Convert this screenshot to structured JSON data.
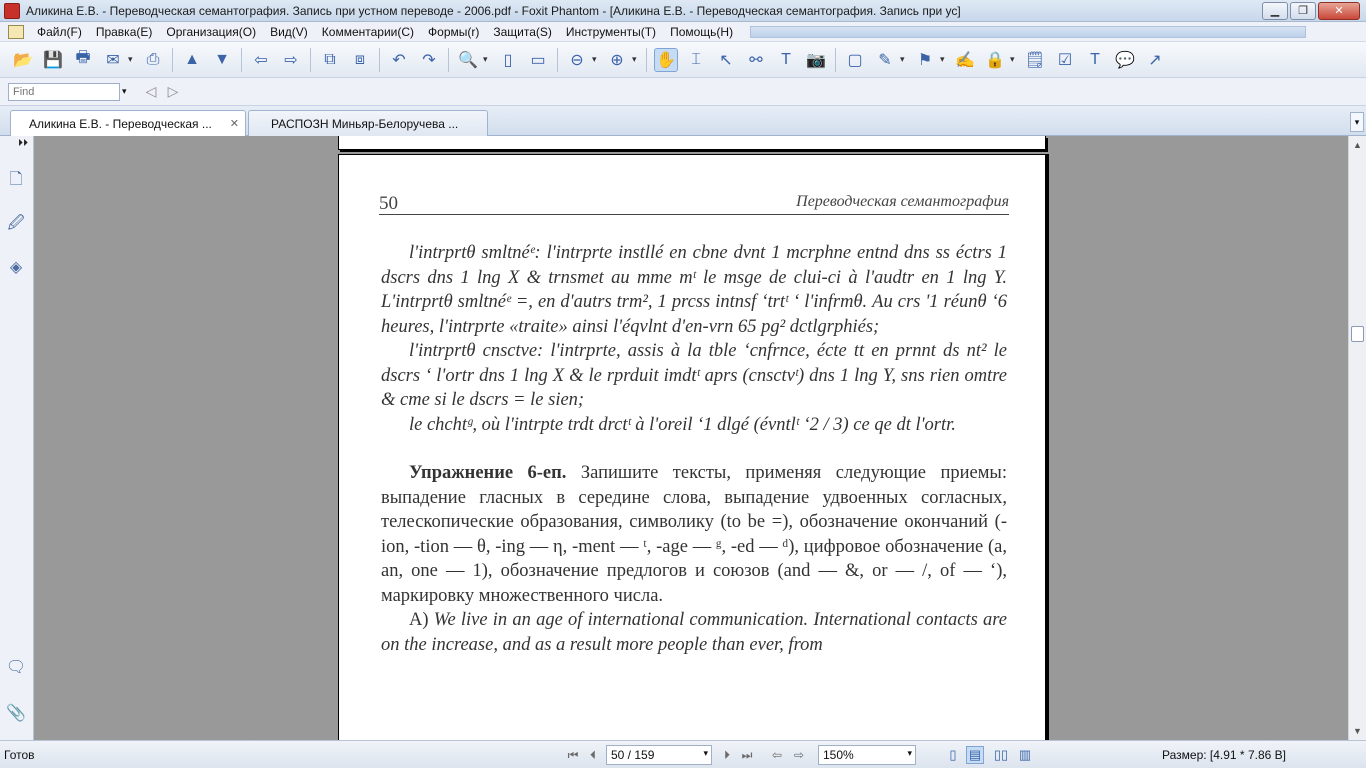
{
  "window": {
    "title": "Аликина Е.В. - Переводческая семантография. Запись при устном переводе - 2006.pdf - Foxit Phantom - [Аликина Е.В. - Переводческая семантография. Запись при ус]",
    "minimize": "▁",
    "restore": "❐",
    "close": "✕"
  },
  "menu": {
    "items": [
      "Файл(F)",
      "Правка(E)",
      "Организация(O)",
      "Вид(V)",
      "Комментарии(C)",
      "Формы(r)",
      "Защита(S)",
      "Инструменты(T)",
      "Помощь(H)"
    ]
  },
  "toolbar": {
    "icons": [
      {
        "name": "open-icon",
        "glyph": "📂"
      },
      {
        "name": "save-icon",
        "glyph": "💾"
      },
      {
        "name": "print-icon",
        "glyph": "🖶"
      },
      {
        "name": "email-icon",
        "glyph": "✉"
      },
      {
        "name": "scan-icon",
        "glyph": "⎙"
      },
      {
        "name": "page-up-icon",
        "glyph": "▲"
      },
      {
        "name": "page-down-icon",
        "glyph": "▼"
      },
      {
        "name": "back-icon",
        "glyph": "⇦"
      },
      {
        "name": "forward-icon",
        "glyph": "⇨"
      },
      {
        "name": "extract-icon",
        "glyph": "⧉"
      },
      {
        "name": "insert-icon",
        "glyph": "⧈"
      },
      {
        "name": "undo-icon",
        "glyph": "↶"
      },
      {
        "name": "redo-icon",
        "glyph": "↷"
      },
      {
        "name": "zoom-icon",
        "glyph": "🔍"
      },
      {
        "name": "fit-page-icon",
        "glyph": "▯"
      },
      {
        "name": "fit-width-icon",
        "glyph": "▭"
      },
      {
        "name": "zoom-out-icon",
        "glyph": "⊖"
      },
      {
        "name": "zoom-in-icon",
        "glyph": "⊕"
      },
      {
        "name": "hand-tool-icon",
        "glyph": "✋"
      },
      {
        "name": "text-select-icon",
        "glyph": "⌶"
      },
      {
        "name": "arrow-select-icon",
        "glyph": "↖"
      },
      {
        "name": "binoculars-icon",
        "glyph": "⚯"
      },
      {
        "name": "typewriter-icon",
        "glyph": "T"
      },
      {
        "name": "snapshot-icon",
        "glyph": "📷"
      },
      {
        "name": "textbox-icon",
        "glyph": "▢"
      },
      {
        "name": "edit-icon",
        "glyph": "✎"
      },
      {
        "name": "stamp-icon",
        "glyph": "⚑"
      },
      {
        "name": "sign-icon",
        "glyph": "✍"
      },
      {
        "name": "lock-icon",
        "glyph": "🔒"
      },
      {
        "name": "note-icon",
        "glyph": "🗒"
      },
      {
        "name": "check-note-icon",
        "glyph": "☑"
      },
      {
        "name": "text-note-icon",
        "glyph": "T"
      },
      {
        "name": "comment-icon",
        "glyph": "💬"
      },
      {
        "name": "arrow-tool-icon",
        "glyph": "↗"
      }
    ]
  },
  "find": {
    "placeholder": "Find",
    "prev": "◁",
    "next": "▷"
  },
  "tabs": [
    {
      "label": "Аликина Е.В. - Переводческая ...",
      "close": "✕"
    },
    {
      "label": "РАСПОЗН Миньяр-Белоручева ..."
    }
  ],
  "tab_scroll": "▾",
  "sidepanel": {
    "collapse": "⏵⏵",
    "icons": [
      {
        "name": "pages-icon",
        "glyph": "🗋"
      },
      {
        "name": "bookmarks-icon",
        "glyph": "🖉"
      },
      {
        "name": "layers-icon",
        "glyph": "◈"
      },
      {
        "name": "comments-panel-icon",
        "glyph": "🗨"
      },
      {
        "name": "attachments-icon",
        "glyph": "📎"
      }
    ]
  },
  "page": {
    "number": "50",
    "header": "Переводческая семантография",
    "p1": "l'intrprtθ smltnéᵉ: l'intrprte instllé en cbne dvnt 1 mcrphne entnd dns ss éctrs 1 dscrs dns 1 lng X & trnsmet au mme mᵗ le msge de clui-ci à l'audtr en 1 lng Y. L'intrprtθ smltnéᵉ =, en d'autrs trm², 1 prcss intnsf ‘trtᵗ ‘ l'infrmθ. Au crs '1 réunθ ‘6 heures, l'intrprte «traite» ainsi l'éqvlnt d'en-vrn 65 pg² dctlgrphiés;",
    "p2": "l'intrprtθ cnsctve: l'intrprte, assis à la tble ‘cnfrnce, écte tt en prnnt ds nt² le dscrs ‘ l'ortr dns 1 lng X & le rprduit imdtᵗ aprs (cnsctvᵗ) dns 1 lng Y, sns rien omtre & cme si le dscrs = le sien;",
    "p3": "le chchtᵍ, où l'intrpte trdt drctᵗ à l'oreil ‘1 dlgé (évntlᵗ ‘2 / 3) ce qe dt l'ortr.",
    "ex_title": "Упражнение 6-еп.",
    "ex_body": " Запишите тексты, применяя следующие приемы: выпадение гласных в середине слова, выпадение удвоенных согласных, телескопические образования, символику (to be =), обозначение окончаний (-ion, -tion — θ, -ing — η, -ment — ᵗ, -age — ᵍ, -ed — ᵈ), цифровое обозначение (a, an, one — 1), обозначение предлогов и союзов (and — &, or — /, of — ‘), маркировку множественного числа.",
    "p4_label": "А) ",
    "p4": "We live in an age of international communication. International contacts are on the increase, and as a result more people than ever, from"
  },
  "status": {
    "ready": "Готов",
    "first": "⏮",
    "prev": "⏴",
    "page_value": "50 / 159",
    "next": "⏵",
    "last": "⏭",
    "back": "⇦",
    "forward": "⇨",
    "zoom": "150%",
    "dropdown": "▾",
    "size": "Размер: [4.91 * 7.86 В]"
  },
  "colors": {
    "doc_background": "#999999",
    "title_bar": "#c7d7ea",
    "active_tool": "#c6dcf5"
  }
}
